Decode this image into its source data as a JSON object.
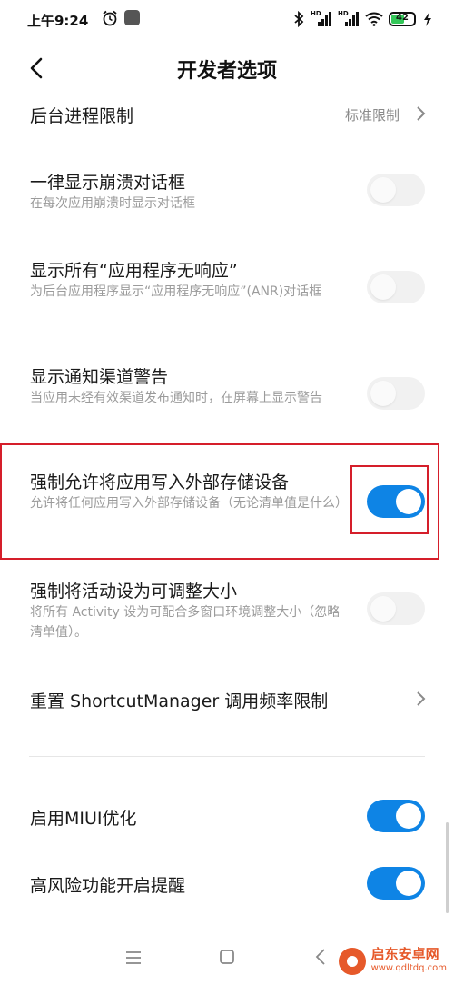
{
  "status_bar": {
    "time": "上午9:24",
    "battery_level": "42",
    "network_badge_1": "HD",
    "network_badge_2": "HD"
  },
  "header": {
    "title": "开发者选项"
  },
  "rows": {
    "background_limit": {
      "label": "后台进程限制",
      "value": "标准限制"
    },
    "show_crash_dialog": {
      "label": "一律显示崩溃对话框",
      "sub": "在每次应用崩溃时显示对话框",
      "enabled": false
    },
    "show_all_anr": {
      "label": "显示所有“应用程序无响应”",
      "sub": "为后台应用程序显示“应用程序无响应”(ANR)对话框",
      "enabled": false
    },
    "notification_channel_warning": {
      "label": "显示通知渠道警告",
      "sub": "当应用未经有效渠道发布通知时，在屏幕上显示警告",
      "enabled": false
    },
    "force_external_storage": {
      "label": "强制允许将应用写入外部存储设备",
      "sub": "允许将任何应用写入外部存储设备（无论清单值是什么）",
      "enabled": true
    },
    "force_resizable": {
      "label": "强制将活动设为可调整大小",
      "sub": "将所有 Activity 设为可配合多窗口环境调整大小（忽略清单值）。",
      "enabled": false
    },
    "reset_shortcut_manager": {
      "label": "重置 ShortcutManager 调用频率限制"
    },
    "enable_miui_optimization": {
      "label": "启用MIUI优化",
      "enabled": true
    },
    "high_risk_reminder": {
      "label": "高风险功能开启提醒",
      "enabled": true
    }
  },
  "watermark": {
    "name": "启东安卓网",
    "url": "www.qdltdq.com"
  },
  "colors": {
    "accent": "#0e84e5",
    "highlight": "#d51e2a",
    "watermark": "#e6592a"
  }
}
